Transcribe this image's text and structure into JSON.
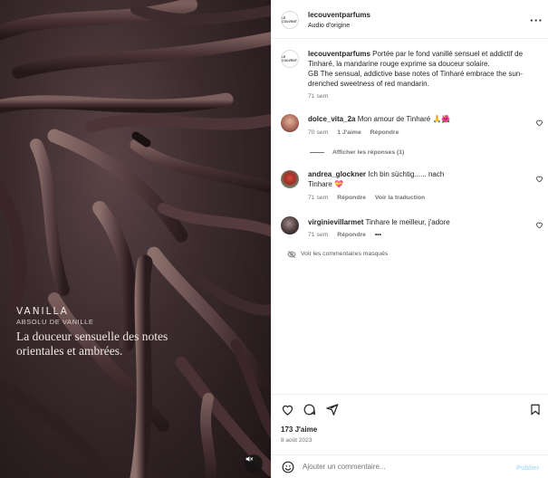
{
  "post": {
    "username": "lecouventparfums",
    "audio": "Audio d'origine",
    "avatar_text": "LE COUVENT"
  },
  "media": {
    "title": "VANILLA",
    "subtitle": "ABSOLU DE VANILLE",
    "tagline": "La douceur sensuelle des notes orientales et ambrées."
  },
  "caption": {
    "username": "lecouventparfums",
    "text_fr": "Portée par le fond vanillé sensuel et addictif de Tinharé, la mandarine rouge exprime sa douceur solaire.",
    "text_en": "GB The sensual, addictive base notes of Tinharé embrace the sun-drenched sweetness of red mandarin.",
    "time": "71 sem"
  },
  "comments": [
    {
      "username": "dolce_vita_2a",
      "text": "Mon amour de Tinharé",
      "emoji": "🙏🌺",
      "time": "70 sem",
      "likes": "1 J'aime",
      "reply": "Répondre",
      "view_replies": "Afficher les réponses (1)"
    },
    {
      "username": "andrea_glockner",
      "text": "Ich bin süchtig...... nach Tinhare",
      "emoji": "💝",
      "time": "71 sem",
      "reply": "Répondre",
      "translate": "Voir la traduction"
    },
    {
      "username": "virginievillarmet",
      "text": "Tinhare le meilleur, j'adore",
      "time": "71 sem",
      "reply": "Répondre",
      "more": "•••"
    }
  ],
  "hidden_comments": "Voir les commentaires masqués",
  "likes": "173 J'aime",
  "date": "8 août 2023",
  "comment_box": {
    "placeholder": "Ajouter un commentaire...",
    "publish": "Publier"
  },
  "icons": {
    "heart": "heart-icon",
    "comment": "comment-icon",
    "share": "share-icon",
    "save": "bookmark-icon",
    "emoji": "emoji-icon",
    "mute": "muted-speaker-icon",
    "more": "more-icon",
    "hidden": "eye-off-icon"
  },
  "colors": {
    "text": "#262626",
    "secondary": "#737373",
    "publish_disabled": "#b2dffc",
    "border": "#efefef"
  }
}
